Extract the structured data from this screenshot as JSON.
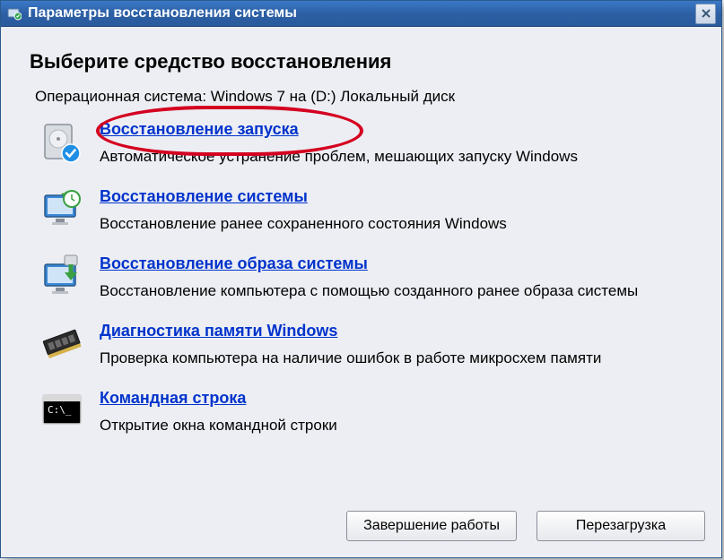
{
  "window": {
    "title": "Параметры восстановления системы"
  },
  "main": {
    "heading": "Выберите средство восстановления",
    "os_line": "Операционная система: Windows 7 на (D:) Локальный диск"
  },
  "tools": [
    {
      "link": "Восстановление запуска",
      "desc": "Автоматическое устранение проблем, мешающих запуску Windows",
      "highlighted": true
    },
    {
      "link": "Восстановление системы",
      "desc": "Восстановление ранее сохраненного состояния Windows"
    },
    {
      "link": "Восстановление образа системы",
      "desc": "Восстановление компьютера с помощью  созданного ранее образа системы"
    },
    {
      "link": "Диагностика памяти Windows",
      "desc": "Проверка компьютера на наличие ошибок в работе микросхем памяти"
    },
    {
      "link": "Командная строка",
      "desc": "Открытие окна командной строки"
    }
  ],
  "buttons": {
    "shutdown": "Завершение работы",
    "restart": "Перезагрузка"
  }
}
